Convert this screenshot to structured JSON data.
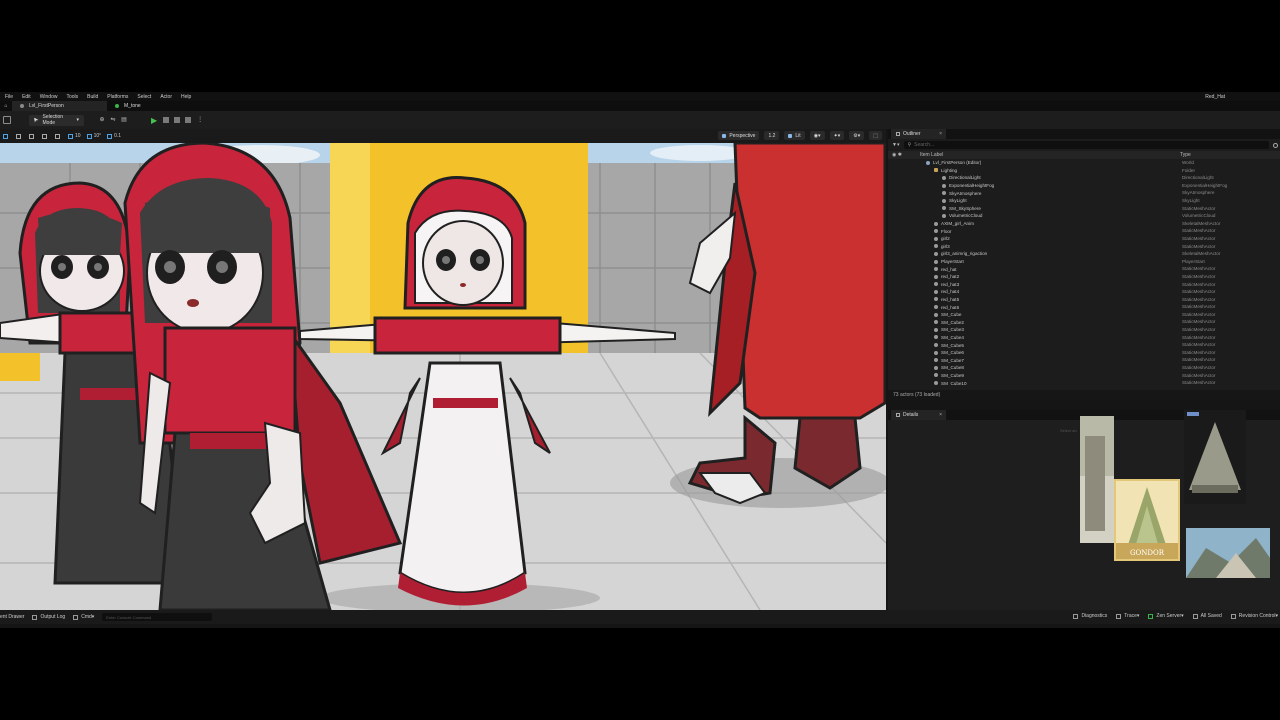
{
  "menu": [
    "File",
    "Edit",
    "Window",
    "Tools",
    "Build",
    "Platforms",
    "Select",
    "Actor",
    "Help"
  ],
  "project_name": "Red_Hat",
  "tabs": [
    {
      "label": "Lvl_FirstPerson",
      "active": true
    },
    {
      "label": "M_tone",
      "active": false
    }
  ],
  "toolbar": {
    "mode_label": "Selection Mode"
  },
  "viewport_toolbar": {
    "snap_values": [
      "10",
      "10°",
      "0.1"
    ],
    "perspective_label": "Perspective",
    "view_speed": "1.2",
    "lit_label": "Lit"
  },
  "outliner": {
    "tab_label": "Outliner",
    "search_placeholder": "Search...",
    "col_label": "Item Label",
    "col_type": "Type",
    "footer": "73 actors (73 loaded)",
    "rows": [
      {
        "label": "Lvl_FirstPerson (Editor)",
        "type": "World",
        "indent": 0,
        "icon": "world"
      },
      {
        "label": "Lighting",
        "type": "Folder",
        "indent": 1,
        "icon": "folder"
      },
      {
        "label": "DirectionalLight",
        "type": "DirectionalLight",
        "indent": 2,
        "icon": "actor"
      },
      {
        "label": "ExponentialHeightFog",
        "type": "ExponentialHeightFog",
        "indent": 2,
        "icon": "actor"
      },
      {
        "label": "SkyAtmosphere",
        "type": "SkyAtmosphere",
        "indent": 2,
        "icon": "actor"
      },
      {
        "label": "SkyLight",
        "type": "SkyLight",
        "indent": 2,
        "icon": "actor"
      },
      {
        "label": "SM_SkySphere",
        "type": "StaticMeshActor",
        "indent": 2,
        "icon": "actor"
      },
      {
        "label": "VolumetricCloud",
        "type": "VolumetricCloud",
        "indent": 2,
        "icon": "actor"
      },
      {
        "label": "AXIM_girl_Anim",
        "type": "SkeletalMeshActor",
        "indent": 1,
        "icon": "actor"
      },
      {
        "label": "Floor",
        "type": "StaticMeshActor",
        "indent": 1,
        "icon": "actor"
      },
      {
        "label": "girl2",
        "type": "StaticMeshActor",
        "indent": 1,
        "icon": "actor"
      },
      {
        "label": "girl3",
        "type": "StaticMeshActor",
        "indent": 1,
        "icon": "actor"
      },
      {
        "label": "girl3_animrig_rigaction",
        "type": "SkeletalMeshActor",
        "indent": 1,
        "icon": "actor"
      },
      {
        "label": "PlayerStart",
        "type": "PlayerStart",
        "indent": 1,
        "icon": "actor"
      },
      {
        "label": "red_hat",
        "type": "StaticMeshActor",
        "indent": 1,
        "icon": "actor"
      },
      {
        "label": "red_hat2",
        "type": "StaticMeshActor",
        "indent": 1,
        "icon": "actor"
      },
      {
        "label": "red_hat3",
        "type": "StaticMeshActor",
        "indent": 1,
        "icon": "actor"
      },
      {
        "label": "red_hat4",
        "type": "StaticMeshActor",
        "indent": 1,
        "icon": "actor"
      },
      {
        "label": "red_hat5",
        "type": "StaticMeshActor",
        "indent": 1,
        "icon": "actor"
      },
      {
        "label": "red_hat6",
        "type": "StaticMeshActor",
        "indent": 1,
        "icon": "actor"
      },
      {
        "label": "SM_Cube",
        "type": "StaticMeshActor",
        "indent": 1,
        "icon": "actor"
      },
      {
        "label": "SM_Cube2",
        "type": "StaticMeshActor",
        "indent": 1,
        "icon": "actor"
      },
      {
        "label": "SM_Cube3",
        "type": "StaticMeshActor",
        "indent": 1,
        "icon": "actor"
      },
      {
        "label": "SM_Cube4",
        "type": "StaticMeshActor",
        "indent": 1,
        "icon": "actor"
      },
      {
        "label": "SM_Cube5",
        "type": "StaticMeshActor",
        "indent": 1,
        "icon": "actor"
      },
      {
        "label": "SM_Cube6",
        "type": "StaticMeshActor",
        "indent": 1,
        "icon": "actor"
      },
      {
        "label": "SM_Cube7",
        "type": "StaticMeshActor",
        "indent": 1,
        "icon": "actor"
      },
      {
        "label": "SM_Cube8",
        "type": "StaticMeshActor",
        "indent": 1,
        "icon": "actor"
      },
      {
        "label": "SM_Cube9",
        "type": "StaticMeshActor",
        "indent": 1,
        "icon": "actor"
      },
      {
        "label": "SM_Cube10",
        "type": "StaticMeshActor",
        "indent": 1,
        "icon": "actor"
      }
    ]
  },
  "details": {
    "tab_label": "Details",
    "hint": "Select an",
    "thumb_caption": "GONDOR"
  },
  "statusbar": {
    "content_drawer": "ent Drawer",
    "output_log": "Output Log",
    "cmd_label": "Cmd",
    "cmd_placeholder": "Enter Console Command",
    "diagnostics": "Diagnostics",
    "trace": "Trace",
    "zen_server": "Zen Server",
    "all_saved": "All Saved",
    "revision_control": "Revision Control"
  }
}
